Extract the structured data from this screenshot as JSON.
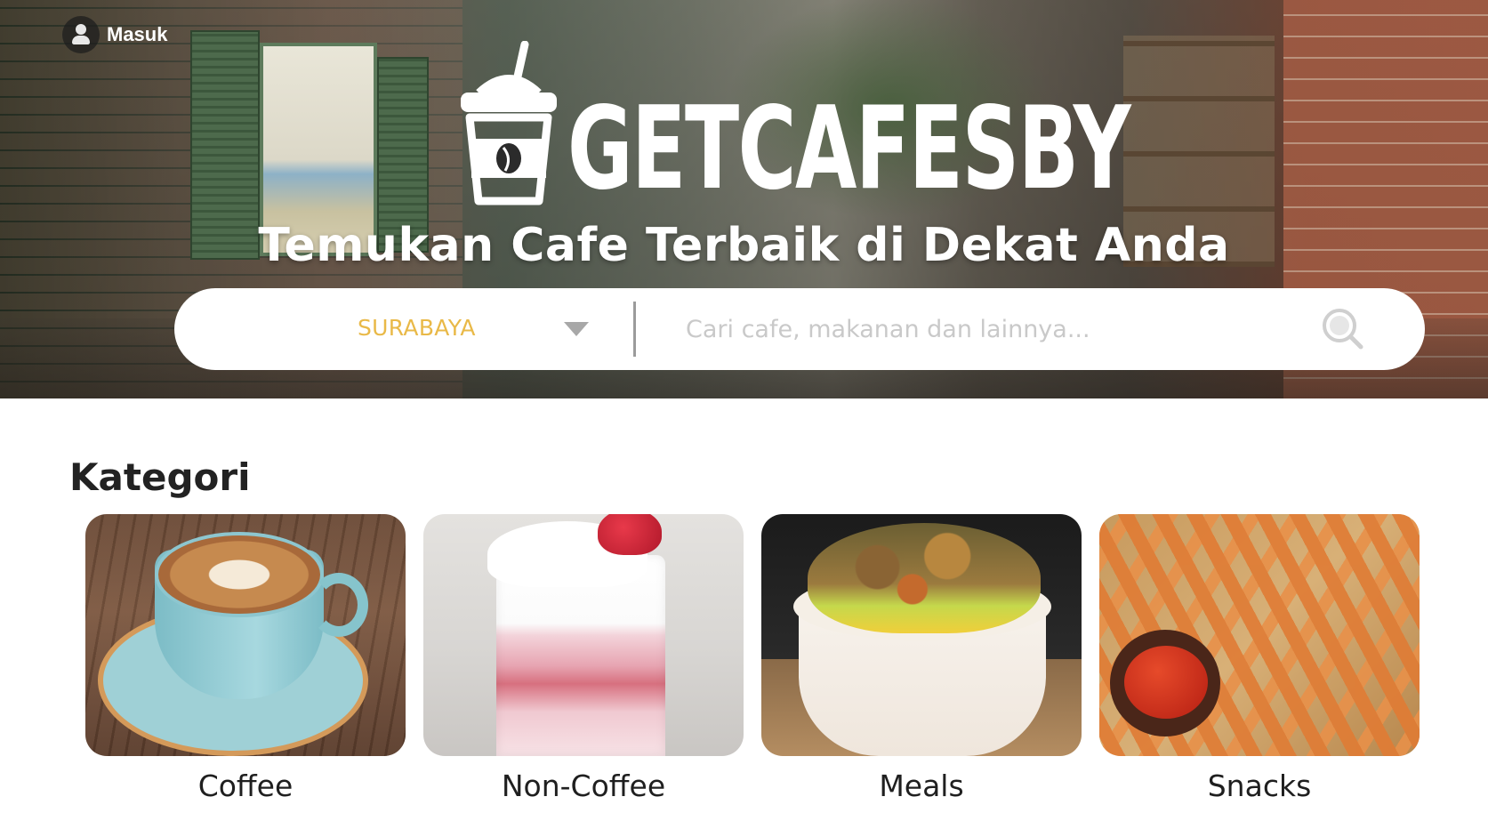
{
  "header": {
    "login_label": "Masuk",
    "brand": "GETCAFESBY",
    "tagline": "Temukan Cafe Terbaik di Dekat Anda"
  },
  "search": {
    "city": "SURABAYA",
    "placeholder": "Cari cafe, makanan dan lainnya...",
    "value": ""
  },
  "category": {
    "title": "Kategori",
    "items": [
      {
        "label": "Coffee",
        "icon": "coffee-photo"
      },
      {
        "label": "Non-Coffee",
        "icon": "non-coffee-photo"
      },
      {
        "label": "Meals",
        "icon": "meals-photo"
      },
      {
        "label": "Snacks",
        "icon": "snacks-photo"
      }
    ]
  },
  "colors": {
    "accent": "#e9b948",
    "placeholder": "#c9c9c9",
    "text": "#1f1f1f"
  }
}
